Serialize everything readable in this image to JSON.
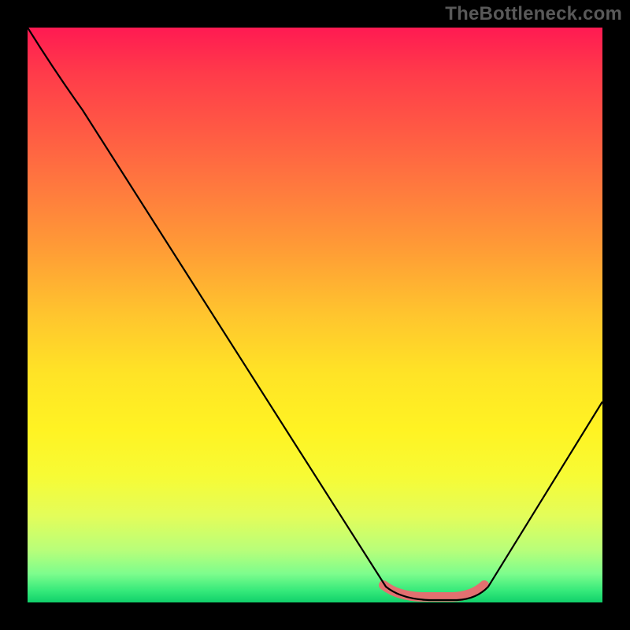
{
  "watermark": "TheBottleneck.com",
  "colors": {
    "highlight": "#e27070",
    "curve": "#000000",
    "background_black": "#000000"
  },
  "chart_data": {
    "type": "line",
    "title": "",
    "xlabel": "",
    "ylabel": "",
    "xlim": [
      0,
      100
    ],
    "ylim": [
      0,
      100
    ],
    "annotations": [],
    "series": [
      {
        "name": "bottleneck-curve",
        "x": [
          0,
          5,
          10,
          15,
          20,
          25,
          30,
          35,
          40,
          45,
          50,
          55,
          60,
          63,
          66,
          70,
          74,
          78,
          82,
          86,
          90,
          95,
          100
        ],
        "y": [
          100,
          95,
          88,
          80,
          72,
          64,
          56,
          48,
          40,
          32,
          24,
          16,
          8,
          3,
          1,
          0,
          0,
          1,
          4,
          9,
          15,
          24,
          35
        ]
      }
    ],
    "highlight_region": {
      "x_start": 62,
      "x_end": 80,
      "description": "optimal-match-flat-minimum"
    },
    "background_gradient": {
      "top": "#ff1a52",
      "middle": "#fff323",
      "bottom": "#10d06a"
    }
  }
}
